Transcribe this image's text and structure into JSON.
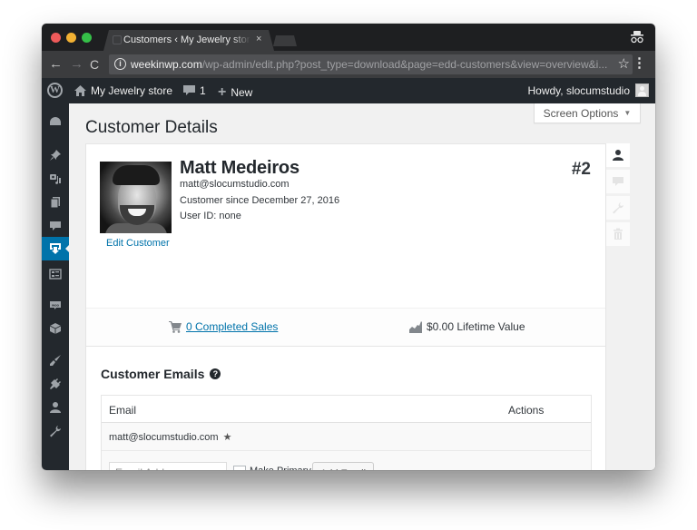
{
  "browser": {
    "tab_title": "Customers ‹ My Jewelry store",
    "tab_close": "×",
    "url_host": "weekinwp.com",
    "url_path": "/wp-admin/edit.php?post_type=download&page=edd-customers&view=overview&i...",
    "back_glyph": "←",
    "forward_glyph": "→",
    "reload_glyph": "C",
    "info_glyph": "i",
    "star_glyph": "☆",
    "menu_glyph": "⋮"
  },
  "adminbar": {
    "wp_logo": "W",
    "site_name": "My Jewelry store",
    "comments_count": "1",
    "new_label": "New",
    "greeting": "Howdy, slocumstudio"
  },
  "sidebar": {
    "items": [
      {
        "name": "dashboard",
        "icon": "dashboard-icon"
      },
      {
        "name": "posts",
        "icon": "pin-icon"
      },
      {
        "name": "media",
        "icon": "media-icon"
      },
      {
        "name": "pages",
        "icon": "pages-icon"
      },
      {
        "name": "comments",
        "icon": "comment-icon"
      },
      {
        "name": "downloads",
        "icon": "download-icon",
        "active": true
      },
      {
        "name": "forms",
        "icon": "list-icon"
      },
      {
        "name": "woocommerce",
        "icon": "woo-icon"
      },
      {
        "name": "products",
        "icon": "box-icon"
      },
      {
        "name": "appearance",
        "icon": "brush-icon"
      },
      {
        "name": "plugins",
        "icon": "plug-icon"
      },
      {
        "name": "users",
        "icon": "user-icon"
      },
      {
        "name": "tools",
        "icon": "wrench-icon"
      }
    ]
  },
  "page": {
    "screen_options_label": "Screen Options",
    "screen_options_arrow": "▼",
    "title": "Customer Details"
  },
  "customer": {
    "name": "Matt Medeiros",
    "email": "matt@slocumstudio.com",
    "since": "Customer since December 27, 2016",
    "user_id": "User ID:  none",
    "id_label": "#2",
    "edit_link": "Edit Customer"
  },
  "stats": {
    "completed_sales": "0 Completed Sales",
    "lifetime_value": "$0.00 Lifetime Value"
  },
  "emails": {
    "heading": "Customer Emails",
    "help_glyph": "?",
    "columns": {
      "email": "Email",
      "actions": "Actions"
    },
    "rows": [
      {
        "email": "matt@slocumstudio.com",
        "primary": true,
        "primary_glyph": "★"
      }
    ],
    "add_form": {
      "input_placeholder": "Email Address",
      "input_value": "",
      "make_primary_label": "Make Primary",
      "make_primary_checked": false,
      "add_button_label": "Add Email"
    }
  },
  "colors": {
    "accent": "#0073aa",
    "adminbar_bg": "#23282d",
    "content_bg": "#f1f1f1"
  }
}
